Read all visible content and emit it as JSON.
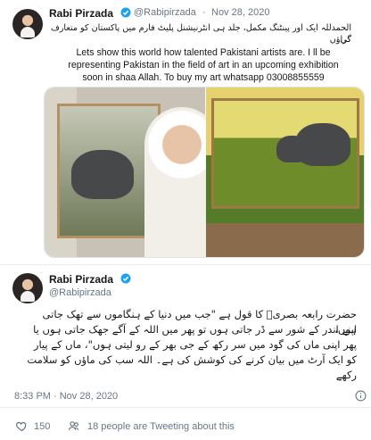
{
  "tweet1": {
    "name": "Rabi Pirzada",
    "handle": "@Rabipirzada",
    "separator": "·",
    "date": "Nov 28, 2020",
    "urdu_line1": "الحمدللہ ایک اور پینٹنگ مکمل، جلد ہی انٹرنیشنل پلیٹ فارم میں پاکستان کو متعارف کراؤں",
    "urdu_line2": "گی۔",
    "english_line1": "Lets show this world how talented Pakistani artists are. I ll be",
    "english_line2": "representing Pakistan in the field of art in an upcoming exhibition",
    "english_line3": "soon in shaa Allah. To buy my art whatsapp 03008855559"
  },
  "tweet2": {
    "name": "Rabi Pirzada",
    "handle": "@Rabipirzada",
    "urdu_line1": "حضرت رابعہ بصریؒ کا قول ہے \"جب میں دنیا کے ہنگاموں سے تھک جاتی ہوں،",
    "urdu_line2": "اپنے اندر کے شور سے ڈر جاتی ہوں تو پھر میں اللہ کے آگے جھک جاتی ہوں یا",
    "urdu_line3": "پھر اپنی ماں کی گود میں سر رکھ کے جی بھر کے رو لیتی ہوں\"، ماں کے پیار",
    "urdu_line4": "کو ایک آرٹ میں بیان کرنے کی کوشش کی ہے۔ اللہ سب کی ماؤں کو سلامت",
    "urdu_line5": "رکھے",
    "timestamp": "8:33 PM · Nov 28, 2020",
    "likes": "150",
    "tweeting_text": "18 people are Tweeting about this"
  },
  "icons": {
    "verified": "verified-icon",
    "heart": "heart-icon",
    "people": "people-icon",
    "info": "info-icon"
  },
  "colors": {
    "verified": "#1da1f2",
    "muted": "#657786",
    "divider": "#e6ecf0"
  }
}
